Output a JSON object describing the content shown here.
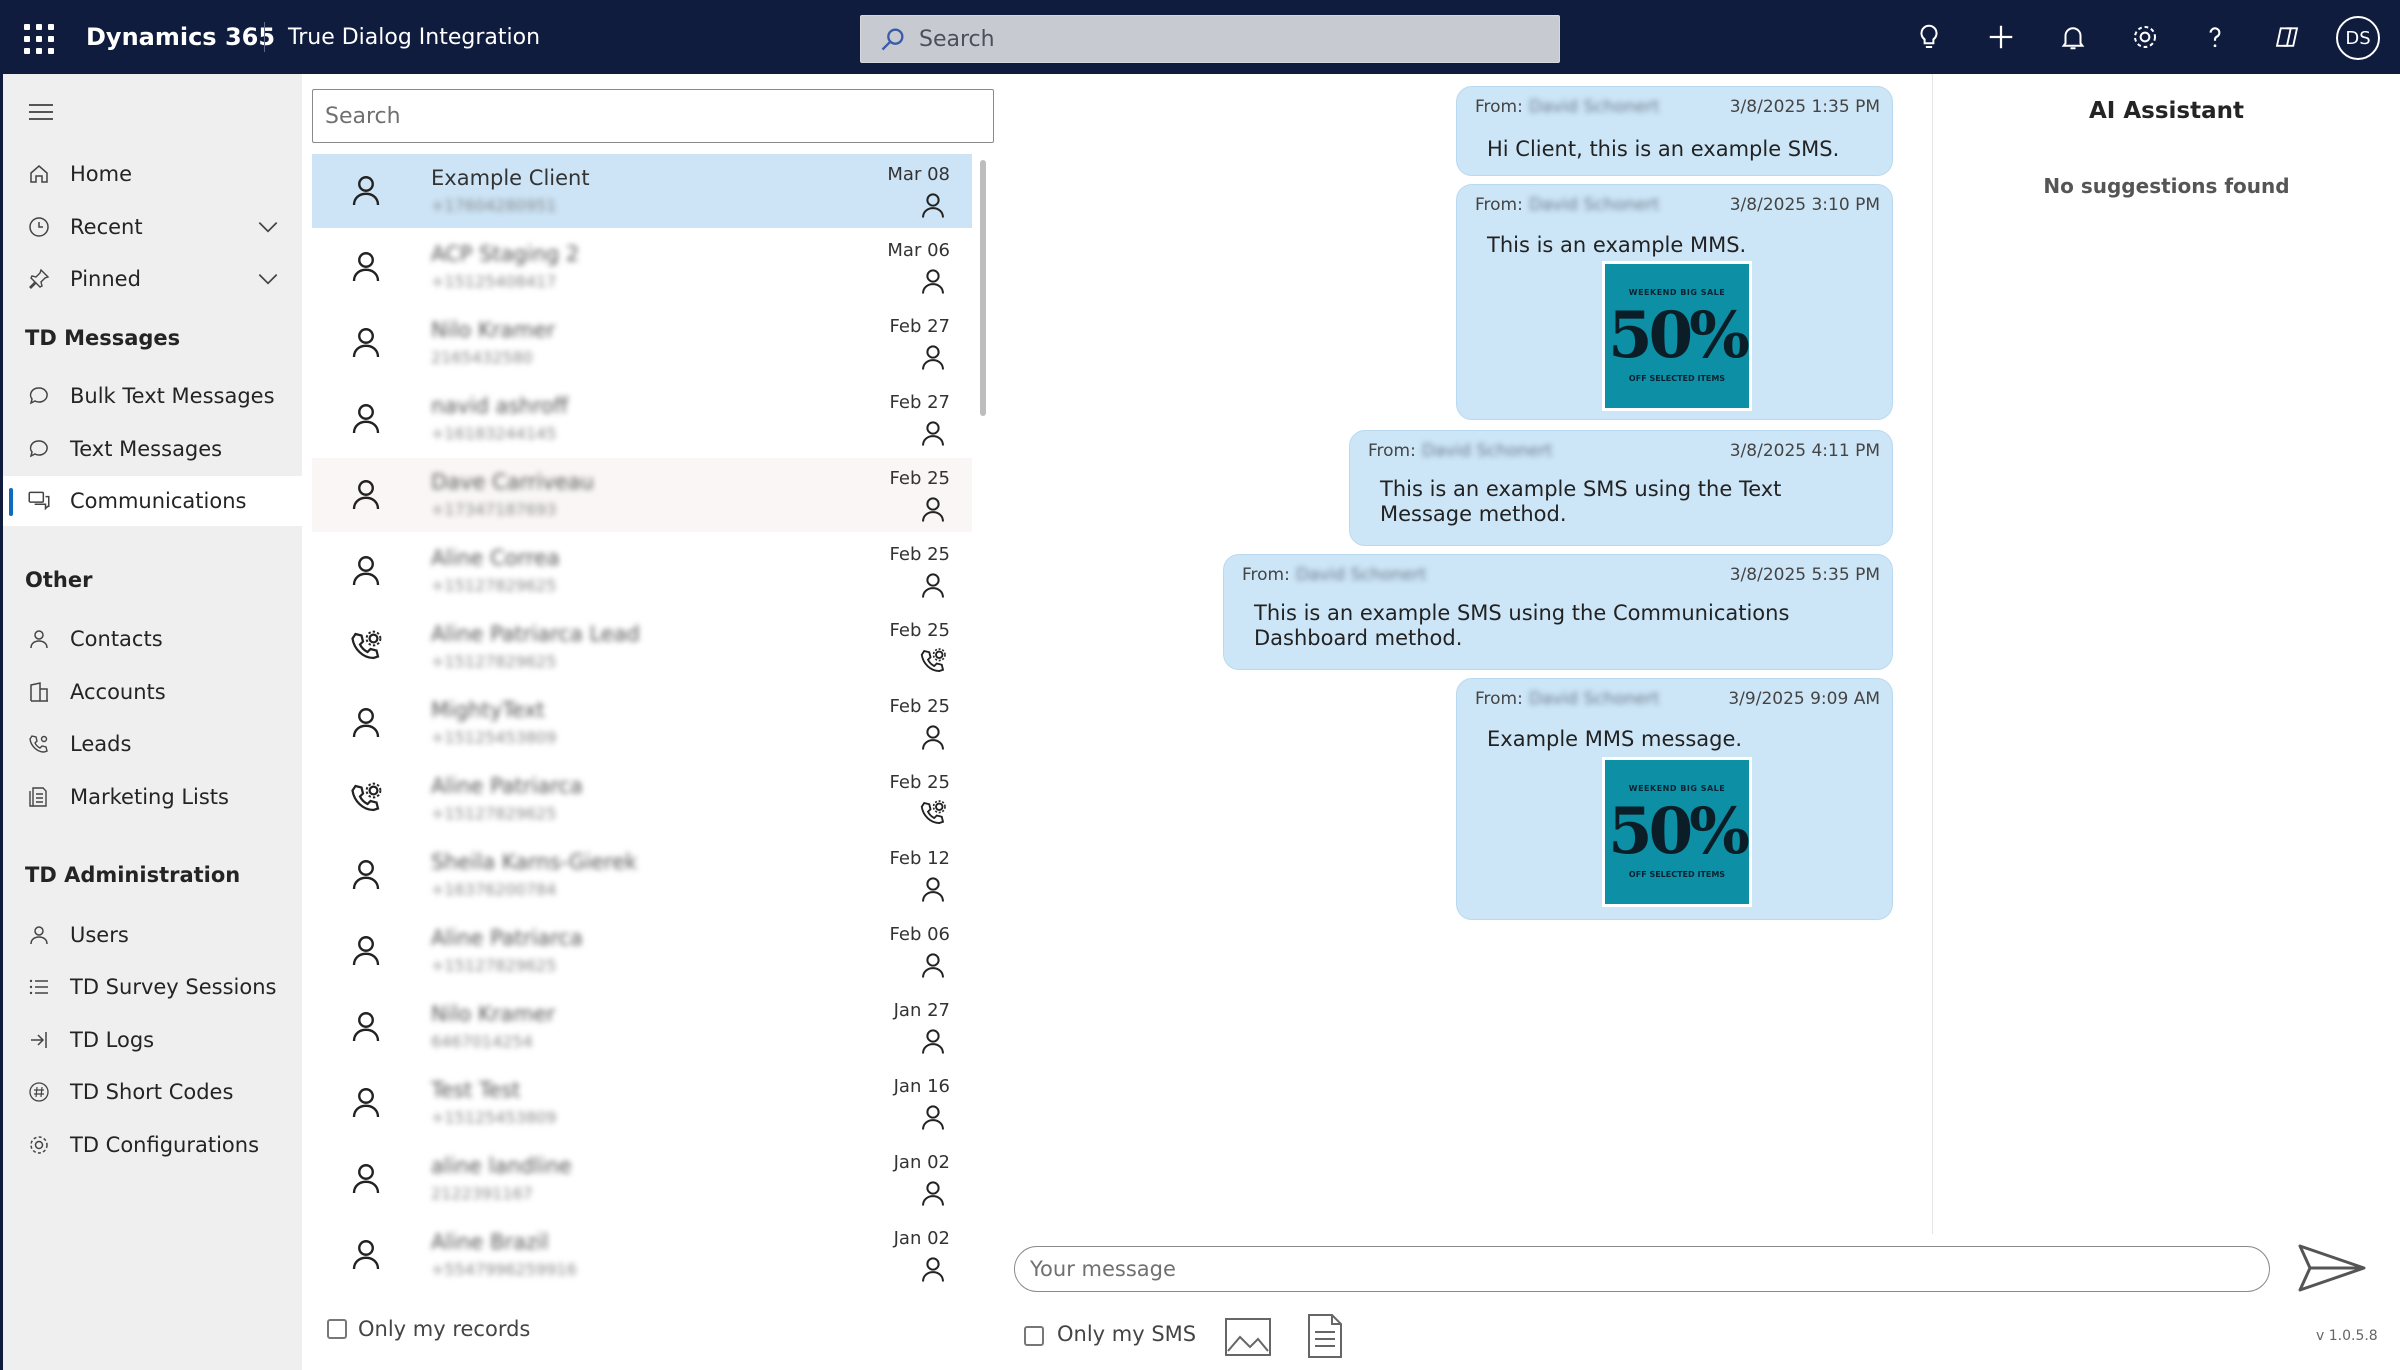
{
  "topbar": {
    "brand": "Dynamics 365",
    "app_name": "True Dialog Integration",
    "search_placeholder": "Search",
    "avatar_initials": "DS",
    "icons": [
      "lightbulb-icon",
      "plus-icon",
      "bell-icon",
      "gear-icon",
      "help-icon",
      "copilot-icon"
    ],
    "bg_color": "#0f1c3e"
  },
  "nav": {
    "items": [
      {
        "label": "Home",
        "icon": "home-icon"
      },
      {
        "label": "Recent",
        "icon": "clock-icon",
        "expandable": true
      },
      {
        "label": "Pinned",
        "icon": "pin-icon",
        "expandable": true
      }
    ],
    "section_td_messages": "TD Messages",
    "td_messages": [
      {
        "label": "Bulk Text Messages",
        "icon": "chat-icon"
      },
      {
        "label": "Text Messages",
        "icon": "chat-icon"
      },
      {
        "label": "Communications",
        "icon": "chat-multiple-icon",
        "active": true
      }
    ],
    "section_other": "Other",
    "other": [
      {
        "label": "Contacts",
        "icon": "person-icon"
      },
      {
        "label": "Accounts",
        "icon": "building-icon"
      },
      {
        "label": "Leads",
        "icon": "phone-gear-icon"
      },
      {
        "label": "Marketing Lists",
        "icon": "list-doc-icon"
      }
    ],
    "section_td_admin": "TD Administration",
    "td_admin": [
      {
        "label": "Users",
        "icon": "person-icon"
      },
      {
        "label": "TD Survey Sessions",
        "icon": "bullet-list-icon"
      },
      {
        "label": "TD Logs",
        "icon": "sign-in-icon"
      },
      {
        "label": "TD Short Codes",
        "icon": "hash-circle-icon"
      },
      {
        "label": "TD Configurations",
        "icon": "gear-icon"
      }
    ]
  },
  "list": {
    "search_placeholder": "Search",
    "only_my_records": "Only my records",
    "conversations": [
      {
        "name": "Example Client",
        "phone": "+17604280951",
        "date": "Mar 08",
        "type": "contact",
        "selected": true
      },
      {
        "name": "ACP Staging 2",
        "phone": "+15125408417",
        "date": "Mar 06",
        "type": "contact"
      },
      {
        "name": "Nilo Kramer",
        "phone": "2165432580",
        "date": "Feb 27",
        "type": "contact"
      },
      {
        "name": "navid ashroff",
        "phone": "+16183244145",
        "date": "Feb 27",
        "type": "contact"
      },
      {
        "name": "Dave Carriveau",
        "phone": "+17347187693",
        "date": "Feb 25",
        "type": "contact",
        "hover": true
      },
      {
        "name": "Aline Correa",
        "phone": "+15127829625",
        "date": "Feb 25",
        "type": "contact"
      },
      {
        "name": "Aline Patriarca Lead",
        "phone": "+15127829625",
        "date": "Feb 25",
        "type": "lead"
      },
      {
        "name": "MightyText",
        "phone": "+15125453809",
        "date": "Feb 25",
        "type": "contact"
      },
      {
        "name": "Aline Patriarca",
        "phone": "+15127829625",
        "date": "Feb 25",
        "type": "lead"
      },
      {
        "name": "Sheila Karns-Gierek",
        "phone": "+16376200784",
        "date": "Feb 12",
        "type": "contact"
      },
      {
        "name": "Aline Patriarca",
        "phone": "+15127829625",
        "date": "Feb 06",
        "type": "contact"
      },
      {
        "name": "Nilo Kramer",
        "phone": "6467014254",
        "date": "Jan 27",
        "type": "contact"
      },
      {
        "name": "Test Test",
        "phone": "+15125453809",
        "date": "Jan 16",
        "type": "contact"
      },
      {
        "name": "aline landline",
        "phone": "2122391167",
        "date": "Jan 02",
        "type": "contact"
      },
      {
        "name": "Aline Brazil",
        "phone": "+5547996259916",
        "date": "Jan 02",
        "type": "contact"
      }
    ]
  },
  "messages": [
    {
      "from_label": "From:",
      "sender": "David Schonert",
      "time": "3/8/2025 1:35 PM",
      "text": "Hi Client, this is an example SMS."
    },
    {
      "from_label": "From:",
      "sender": "David Schonert",
      "time": "3/8/2025 3:10 PM",
      "text": "This is an example MMS.",
      "image": {
        "line1": "WEEKEND BIG SALE",
        "line2": "50%",
        "line3": "OFF SELECTED ITEMS"
      }
    },
    {
      "from_label": "From:",
      "sender": "David Schonert",
      "time": "3/8/2025 4:11 PM",
      "text": "This is an example SMS using the Text Message method."
    },
    {
      "from_label": "From:",
      "sender": "David Schonert",
      "time": "3/8/2025 5:35 PM",
      "text": "This is an example SMS using the Communications Dashboard method."
    },
    {
      "from_label": "From:",
      "sender": "David Schonert",
      "time": "3/9/2025 9:09 AM",
      "text": "Example MMS message.",
      "image": {
        "line1": "WEEKEND BIG SALE",
        "line2": "50%",
        "line3": "OFF SELECTED ITEMS"
      }
    }
  ],
  "ai": {
    "title": "AI Assistant",
    "empty": "No suggestions found"
  },
  "composer": {
    "placeholder": "Your message",
    "only_my_sms": "Only my SMS",
    "version": "v 1.0.5.8"
  }
}
